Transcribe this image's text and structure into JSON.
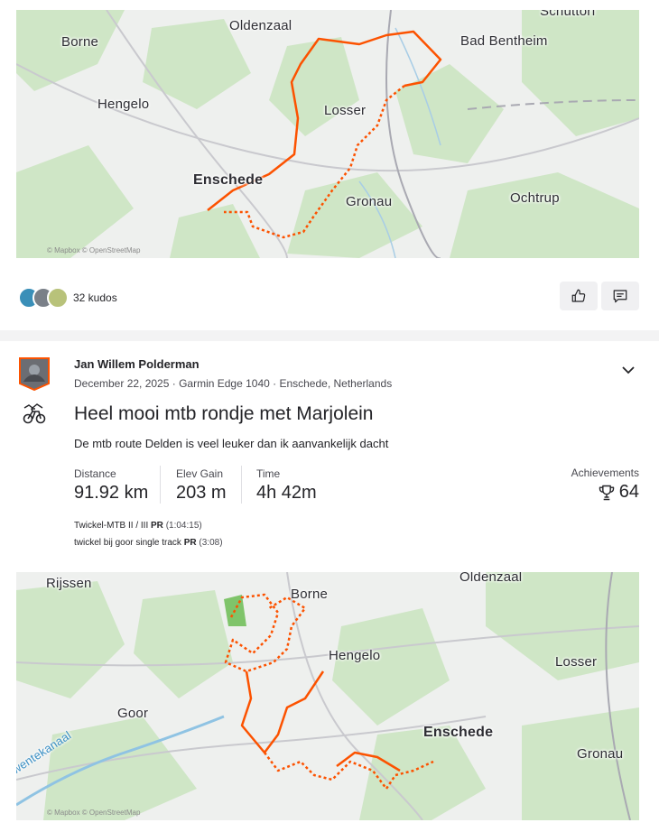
{
  "map1": {
    "labels": [
      "Borne",
      "Oldenzaal",
      "Hengelo",
      "Losser",
      "Bad Bentheim",
      "Schüttorf",
      "Enschede",
      "Gronau",
      "Ochtrup"
    ],
    "attribution": "© Mapbox © OpenStreetMap"
  },
  "kudos": {
    "text": "32 kudos"
  },
  "activity": {
    "athlete": "Jan Willem Polderman",
    "meta": "December 22, 2025 · Garmin Edge 1040 · Enschede, Netherlands",
    "title": "Heel mooi mtb rondje met Marjolein",
    "description": "De mtb route Delden is veel leuker dan ik aanvankelijk dacht",
    "stats": [
      {
        "label": "Distance",
        "value": "91.92 km"
      },
      {
        "label": "Elev Gain",
        "value": "203 m"
      },
      {
        "label": "Time",
        "value": "4h 42m"
      }
    ],
    "achievements": {
      "label": "Achievements",
      "value": "64"
    },
    "segments": [
      {
        "name": "Twickel-MTB II / III",
        "badge": "PR",
        "time": "(1:04:15)"
      },
      {
        "name": "twickel bij goor single track",
        "badge": "PR",
        "time": "(3:08)"
      }
    ]
  },
  "map2": {
    "labels": [
      "Rijssen",
      "Oldenzaal",
      "Borne",
      "Hengelo",
      "Losser",
      "Goor",
      "Enschede",
      "Gronau",
      "Twentekanaal"
    ],
    "attribution": "© Mapbox © OpenStreetMap"
  },
  "colors": {
    "route": "#fc5200",
    "map_bg": "#eef0ee",
    "green": "#cfe6c6"
  }
}
